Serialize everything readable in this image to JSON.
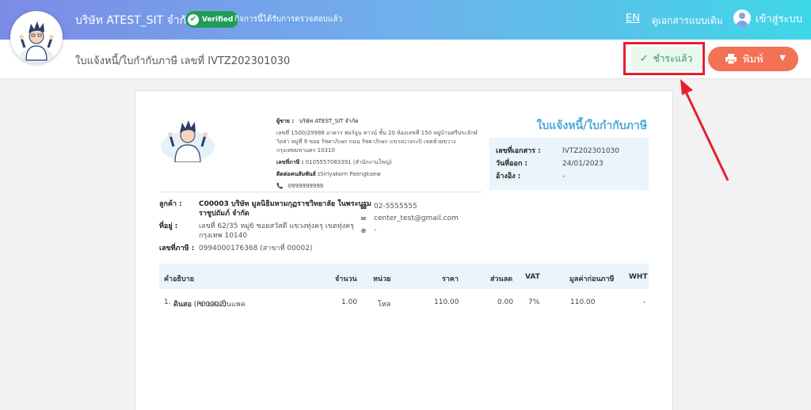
{
  "header": {
    "company_name": "บริษัท ATEST_SIT จำกัด",
    "verified_label": "Verified",
    "verified_note": "กิจการนี้ได้รับการตรวจสอบแล้ว",
    "lang": "EN",
    "old_version": "ดูเอกสารแบบเดิม",
    "login": "เข้าสู่ระบบ"
  },
  "subheader": {
    "document_title": "ใบแจ้งหนี้/ใบกำกับภาษี เลขที่ IVTZ202301030",
    "paid_label": "ชำระแล้ว",
    "print_label": "พิมพ์"
  },
  "seller": {
    "seller_label": "ผู้ขาย :",
    "seller_name": "บริษัท ATEST_SIT จำกัด",
    "address": "เลขที่ 1500/29988 อาคาร ฟอร์จูน ทาวน์ ชั้น 20 ห้องเลขที่ 150 หมู่บ้านศรีประจักษ์วิลล่า หมู่ที่ 9 ซอย รัชดาภิเษก ถนน รัชดาภิเษก แขวงบางกะปิ เขตห้วยขวาง กรุงเทพมหานคร 10310",
    "tax_label": "เลขที่ภาษี :",
    "tax_id": "0105557083391 (สำนักงานใหญ่)",
    "contact_label": "ติดต่อคนสัมพันธ์ :",
    "contact_name": "Siriyakorn Paengkaew",
    "phone": "0999999999"
  },
  "document": {
    "title": "ใบแจ้งหนี้/ใบกำกับภาษี",
    "doc_no_label": "เลขที่เอกสาร :",
    "doc_no": "IVTZ202301030",
    "issue_label": "วันที่ออก :",
    "issue_date": "24/01/2023",
    "ref_label": "อ้างอิง :",
    "ref": "-"
  },
  "customer": {
    "customer_label": "ลูกค้า :",
    "customer_name": "C00003 บริษัท มูลนิธิมหามกุฏราชวิทยาลัย ในพระบรมราชูปถัมภ์ จำกัด",
    "address_label": "ที่อยู่ :",
    "address": "เลขที่ 62/35 หมู่6 ซอยสวัสดี แขวงทุ่งครุ เขตทุ่งครุ กรุงเทพ 10140",
    "tax_label": "เลขที่ภาษี :",
    "tax_id": "0994000176368 (สาขาที่ 00002)",
    "phone": "02-5555555",
    "email": "center_test@gmail.com",
    "website": "-"
  },
  "table": {
    "headers": [
      "คำอธิบาย",
      "จำนวน",
      "หน่วย",
      "ราคา",
      "ส่วนลด",
      "VAT",
      "มูลค่าก่อนภาษี",
      "WHT"
    ],
    "rows": [
      {
        "index": "1.",
        "name": "ดินสอ",
        "code": "(P00002)",
        "sub": "ดินสอ : ขายส่งเป็นแพค",
        "qty": "1.00",
        "unit": "โหล",
        "price": "110.00",
        "discount": "0.00",
        "vat": "7%",
        "amount": "110.00",
        "wht": "-"
      }
    ]
  },
  "colors": {
    "accent": "#4aa9d6",
    "paid_green": "#2e9c5a",
    "print_orange": "#f37154",
    "highlight_red": "#e5202b"
  }
}
